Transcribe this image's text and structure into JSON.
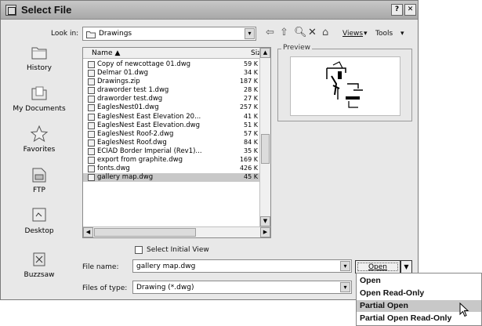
{
  "window": {
    "title": "Select File",
    "help_label": "?",
    "close_label": "✕"
  },
  "look_in": {
    "label": "Look in:",
    "value": "Drawings"
  },
  "toolbar": {
    "views_label": "Views",
    "tools_label": "Tools"
  },
  "places": [
    {
      "label": "History"
    },
    {
      "label": "My Documents"
    },
    {
      "label": "Favorites"
    },
    {
      "label": "FTP"
    },
    {
      "label": "Desktop"
    },
    {
      "label": "Buzzsaw"
    }
  ],
  "file_list": {
    "name_header": "Name",
    "size_header": "Siz",
    "files": [
      {
        "name": "Copy of newcottage 01.dwg",
        "size": "59 K"
      },
      {
        "name": "Delmar 01.dwg",
        "size": "34 K"
      },
      {
        "name": "Drawings.zip",
        "size": "187 K"
      },
      {
        "name": "draworder test 1.dwg",
        "size": "28 K"
      },
      {
        "name": "draworder test.dwg",
        "size": "27 K"
      },
      {
        "name": "EaglesNest01.dwg",
        "size": "257 K"
      },
      {
        "name": "EaglesNest East Elevation 20...",
        "size": "41 K"
      },
      {
        "name": "EaglesNest East Elevation.dwg",
        "size": "51 K"
      },
      {
        "name": "EaglesNest Roof-2.dwg",
        "size": "57 K"
      },
      {
        "name": "EaglesNest Roof.dwg",
        "size": "84 K"
      },
      {
        "name": "ECIAD Border Imperial (Rev1)...",
        "size": "35 K"
      },
      {
        "name": "export from graphite.dwg",
        "size": "169 K"
      },
      {
        "name": "fonts.dwg",
        "size": "426 K"
      },
      {
        "name": "gallery map.dwg",
        "size": "45 K"
      }
    ],
    "selected_index": 13
  },
  "preview": {
    "label": "Preview"
  },
  "select_initial_view": {
    "label": "Select Initial View"
  },
  "file_name": {
    "label": "File name:",
    "value": "gallery map.dwg"
  },
  "files_of_type": {
    "label": "Files of type:",
    "value": "Drawing (*.dwg)"
  },
  "open_button": {
    "label": "Open"
  },
  "open_menu": {
    "items": [
      "Open",
      "Open Read-Only",
      "Partial Open",
      "Partial Open Read-Only"
    ],
    "highlighted_index": 2
  }
}
